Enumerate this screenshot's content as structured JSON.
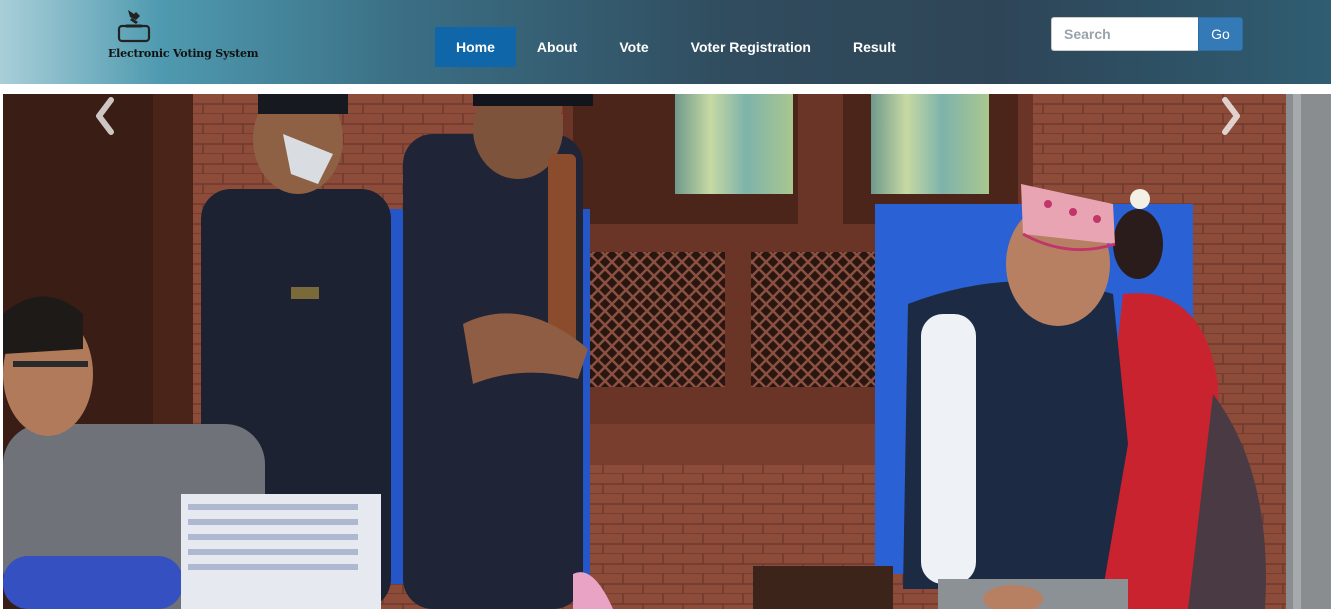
{
  "header": {
    "brand_name": "Electronic Voting System",
    "brand_icon": "ballot-box-icon"
  },
  "nav": {
    "items": [
      {
        "label": "Home",
        "active": true
      },
      {
        "label": "About",
        "active": false
      },
      {
        "label": "Vote",
        "active": false
      },
      {
        "label": "Voter Registration",
        "active": false
      },
      {
        "label": "Result",
        "active": false
      }
    ]
  },
  "search": {
    "placeholder": "Search",
    "value": "",
    "button_label": "Go"
  },
  "carousel": {
    "image_subject": "voters at a polling station with police officers",
    "prev_icon": "chevron-left-icon",
    "next_icon": "chevron-right-icon"
  },
  "colors": {
    "nav_active": "#0f66a8",
    "search_button": "#337ab7",
    "brick": "#8a4a37"
  }
}
